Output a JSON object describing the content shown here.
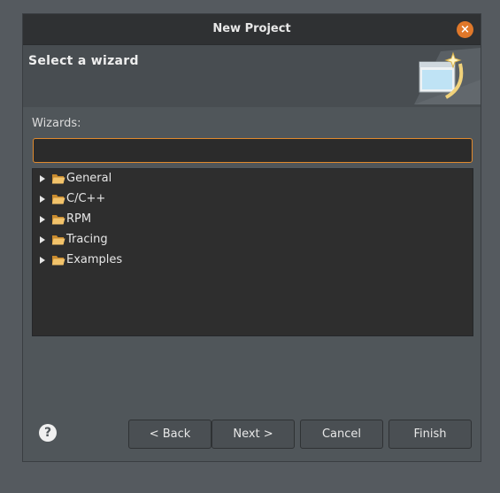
{
  "window": {
    "title": "New Project",
    "close_label": "×"
  },
  "header": {
    "heading": "Select a wizard"
  },
  "wizards": {
    "label": "Wizards:",
    "filter_value": "",
    "items": [
      {
        "label": "General",
        "icon": "folder-icon",
        "expanded": false
      },
      {
        "label": "C/C++",
        "icon": "folder-icon",
        "expanded": false
      },
      {
        "label": "RPM",
        "icon": "folder-icon",
        "expanded": false
      },
      {
        "label": "Tracing",
        "icon": "folder-icon",
        "expanded": false
      },
      {
        "label": "Examples",
        "icon": "folder-icon",
        "expanded": false
      }
    ]
  },
  "footer": {
    "help_label": "?",
    "back_label": "< Back",
    "next_label": "Next >",
    "cancel_label": "Cancel",
    "finish_label": "Finish"
  },
  "colors": {
    "accent": "#e08a2e",
    "close_button": "#e0782a",
    "folder": "#e9a94a"
  }
}
